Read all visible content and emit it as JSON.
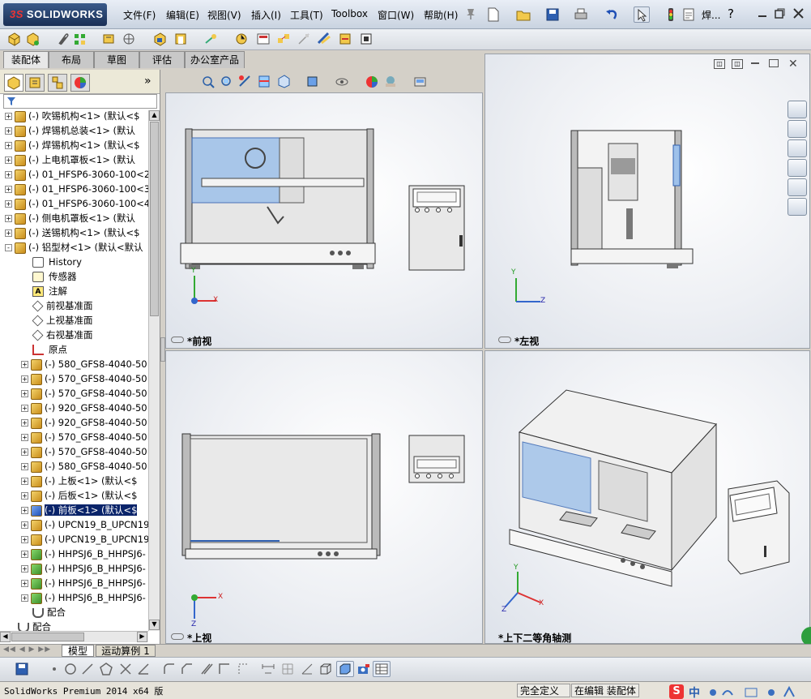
{
  "app": {
    "logo_text": "SOLIDWORKS",
    "logo_prefix": "3S"
  },
  "menu": [
    "文件(F)",
    "编辑(E)",
    "视图(V)",
    "插入(I)",
    "工具(T)",
    "Toolbox",
    "窗口(W)",
    "帮助(H)"
  ],
  "title_doc": "焊...",
  "help_label": "?",
  "commandmanager_tabs": [
    "装配体",
    "布局",
    "草图",
    "评估",
    "办公室产品"
  ],
  "tree": {
    "expand_arrow": "»",
    "components": [
      {
        "expander": "+",
        "label": "(-) 吹锡机构<1> (默认<$",
        "icon": "y"
      },
      {
        "expander": "+",
        "label": "(-) 焊锡机总装<1> (默认",
        "icon": "y"
      },
      {
        "expander": "+",
        "label": "(-) 焊锡机构<1> (默认<$",
        "icon": "y"
      },
      {
        "expander": "+",
        "label": "(-) 上电机罩板<1> (默认",
        "icon": "y"
      },
      {
        "expander": "+",
        "label": "(-) 01_HFSP6-3060-100<2",
        "icon": "y"
      },
      {
        "expander": "+",
        "label": "(-) 01_HFSP6-3060-100<3",
        "icon": "y"
      },
      {
        "expander": "+",
        "label": "(-) 01_HFSP6-3060-100<4",
        "icon": "y"
      },
      {
        "expander": "+",
        "label": "(-) 侧电机罩板<1> (默认",
        "icon": "y"
      },
      {
        "expander": "+",
        "label": "(-) 送锡机构<1> (默认<$",
        "icon": "y"
      },
      {
        "expander": "-",
        "label": "(-) 铝型材<1> (默认<默认",
        "icon": "y"
      }
    ],
    "sub_items": [
      {
        "label": "History",
        "type": "history"
      },
      {
        "label": "传感器",
        "type": "sensor"
      },
      {
        "label": "注解",
        "type": "annot"
      },
      {
        "label": "前视基准面",
        "type": "plane"
      },
      {
        "label": "上视基准面",
        "type": "plane"
      },
      {
        "label": "右视基准面",
        "type": "plane"
      },
      {
        "label": "原点",
        "type": "origin"
      }
    ],
    "parts": [
      {
        "label": "(-) 580_GFS8-4040-50",
        "icon": "y"
      },
      {
        "label": "(-) 570_GFS8-4040-50",
        "icon": "y"
      },
      {
        "label": "(-) 570_GFS8-4040-50",
        "icon": "y"
      },
      {
        "label": "(-) 920_GFS8-4040-50",
        "icon": "y"
      },
      {
        "label": "(-) 920_GFS8-4040-50",
        "icon": "y"
      },
      {
        "label": "(-) 570_GFS8-4040-50",
        "icon": "y"
      },
      {
        "label": "(-) 570_GFS8-4040-50",
        "icon": "y"
      },
      {
        "label": "(-) 580_GFS8-4040-50",
        "icon": "y"
      },
      {
        "label": "(-) 上板<1> (默认<$",
        "icon": "y"
      },
      {
        "label": "(-) 后板<1> (默认<$",
        "icon": "y"
      },
      {
        "label": "(-) 前板<1> (默认<$",
        "icon": "b",
        "selected": true
      },
      {
        "label": "(-) UPCN19_B_UPCN19-",
        "icon": "y"
      },
      {
        "label": "(-) UPCN19_B_UPCN19-",
        "icon": "y"
      },
      {
        "label": "(-) HHPSJ6_B_HHPSJ6-",
        "icon": "g"
      },
      {
        "label": "(-) HHPSJ6_B_HHPSJ6-",
        "icon": "g"
      },
      {
        "label": "(-) HHPSJ6_B_HHPSJ6-",
        "icon": "g"
      },
      {
        "label": "(-) HHPSJ6_B_HHPSJ6-",
        "icon": "g"
      }
    ],
    "mates_inner": "配合",
    "mates_outer": "配合"
  },
  "viewports": {
    "front": "*前视",
    "left": "*左视",
    "top": "*上视",
    "iso": "*上下二等角轴测"
  },
  "axes": {
    "x": "X",
    "y": "Y",
    "z": "Z"
  },
  "bottom_tabs": [
    "模型",
    "运动算例 1"
  ],
  "status": {
    "version": "SolidWorks Premium 2014 x64 版",
    "defined": "完全定义",
    "editing": "在编辑 装配体",
    "ime": "中",
    "ime_brand": "S"
  },
  "colors": {
    "accent": "#0a246a",
    "selected_part": "#5f8fd1",
    "title_bg": "#c9d3e0"
  }
}
